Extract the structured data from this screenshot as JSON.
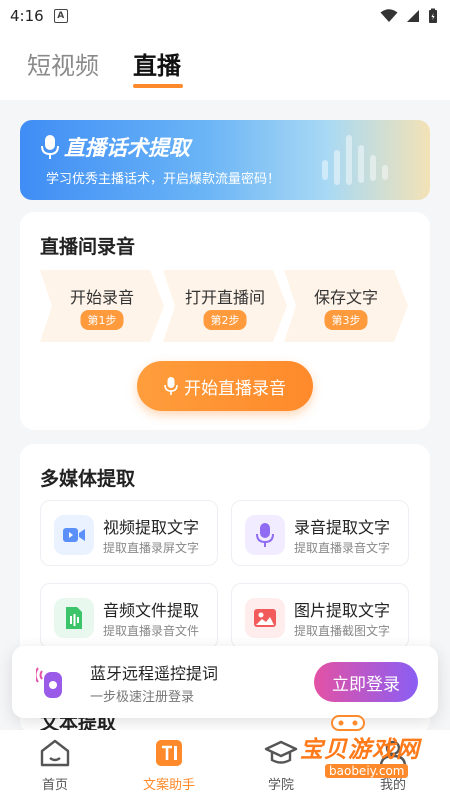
{
  "status": {
    "time": "4:16",
    "notif_glyph": "A"
  },
  "tabs": [
    {
      "label": "短视频"
    },
    {
      "label": "直播"
    }
  ],
  "banner": {
    "title": "直播话术提取",
    "subtitle": "学习优秀主播话术，开启爆款流量密码！"
  },
  "record": {
    "title": "直播间录音",
    "steps": [
      {
        "label": "开始录音",
        "badge": "第1步"
      },
      {
        "label": "打开直播间",
        "badge": "第2步"
      },
      {
        "label": "保存文字",
        "badge": "第3步"
      }
    ],
    "button": "开始直播录音"
  },
  "media": {
    "title": "多媒体提取",
    "items": [
      {
        "title": "视频提取文字",
        "desc": "提取直播录屏文字",
        "icon": "video-icon",
        "color": "#5b8ff9"
      },
      {
        "title": "录音提取文字",
        "desc": "提取直播录音文字",
        "icon": "microphone-icon",
        "color": "#8f6cf2"
      },
      {
        "title": "音频文件提取",
        "desc": "提取直播录音文件",
        "icon": "audio-file-icon",
        "color": "#3cc46a"
      },
      {
        "title": "图片提取文字",
        "desc": "提取直播截图文字",
        "icon": "image-icon",
        "color": "#f25b5b"
      }
    ],
    "next_section_title": "文本提取"
  },
  "toast": {
    "title": "蓝牙远程遥控提词",
    "subtitle": "一步极速注册登录",
    "button": "立即登录"
  },
  "nav": [
    {
      "label": "首页",
      "icon": "home-icon"
    },
    {
      "label": "文案助手",
      "icon": "copywriting-icon"
    },
    {
      "label": "学院",
      "icon": "academy-icon"
    },
    {
      "label": "我的",
      "icon": "profile-icon"
    }
  ],
  "watermark": {
    "text": "宝贝游戏网",
    "url": "baobeiy.com"
  },
  "colors": {
    "accent": "#ff8a2b",
    "banner_blue": "#3f8df5",
    "login_gradient": "#e352a4"
  }
}
